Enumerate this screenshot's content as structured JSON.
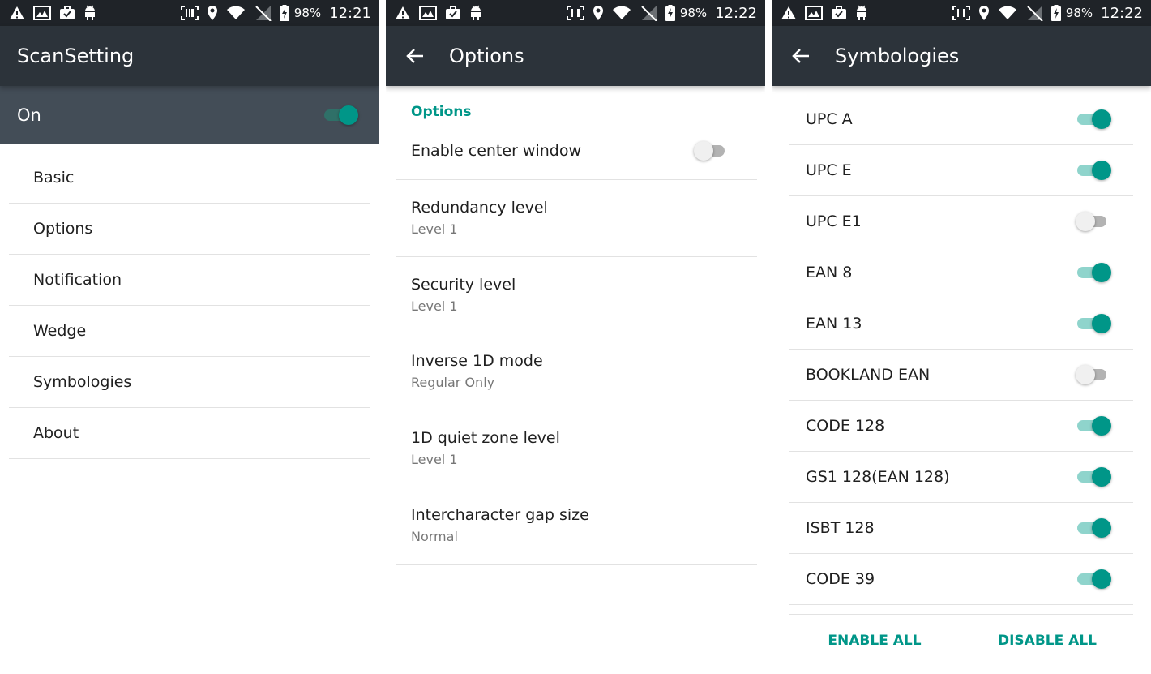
{
  "status_bars": [
    {
      "battery": "98%",
      "time": "12:21"
    },
    {
      "battery": "98%",
      "time": "12:22"
    },
    {
      "battery": "98%",
      "time": "12:22"
    }
  ],
  "screen1": {
    "title": "ScanSetting",
    "master_toggle_label": "On",
    "master_toggle_on": true,
    "menu": [
      {
        "label": "Basic"
      },
      {
        "label": "Options"
      },
      {
        "label": "Notification"
      },
      {
        "label": "Wedge"
      },
      {
        "label": "Symbologies"
      },
      {
        "label": "About"
      }
    ]
  },
  "screen2": {
    "title": "Options",
    "section_header": "Options",
    "enable_center_window": {
      "label": "Enable center window",
      "on": false
    },
    "items": [
      {
        "title": "Redundancy level",
        "value": "Level 1"
      },
      {
        "title": "Security level",
        "value": "Level 1"
      },
      {
        "title": "Inverse 1D mode",
        "value": "Regular Only"
      },
      {
        "title": "1D quiet zone level",
        "value": "Level 1"
      },
      {
        "title": "Intercharacter gap size",
        "value": "Normal"
      }
    ]
  },
  "screen3": {
    "title": "Symbologies",
    "items": [
      {
        "label": "UPC A",
        "on": true
      },
      {
        "label": "UPC E",
        "on": true
      },
      {
        "label": "UPC E1",
        "on": false
      },
      {
        "label": "EAN 8",
        "on": true
      },
      {
        "label": "EAN 13",
        "on": true
      },
      {
        "label": "BOOKLAND EAN",
        "on": false
      },
      {
        "label": "CODE 128",
        "on": true
      },
      {
        "label": "GS1 128(EAN 128)",
        "on": true
      },
      {
        "label": "ISBT 128",
        "on": true
      },
      {
        "label": "CODE 39",
        "on": true
      }
    ],
    "enable_all_label": "ENABLE ALL",
    "disable_all_label": "DISABLE ALL"
  },
  "colors": {
    "accent": "#009688",
    "appbar": "#2c333a",
    "statusbar": "#1f2328",
    "master_bar": "#434d57"
  }
}
